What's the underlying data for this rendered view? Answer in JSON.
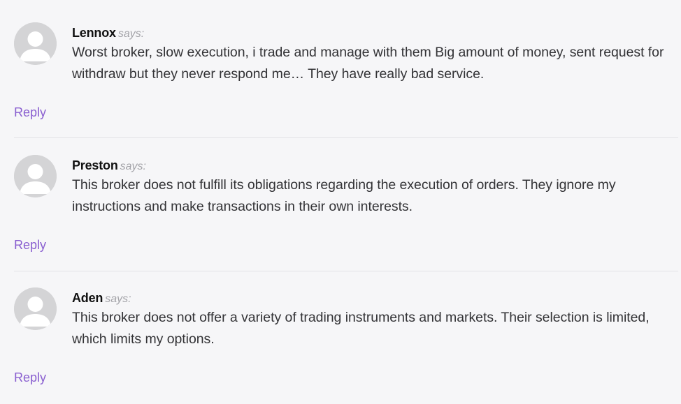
{
  "comments": [
    {
      "author": "Lennox",
      "says": "says:",
      "text": "Worst broker, slow execution, i trade and manage with them Big amount of money, sent request for withdraw but they never respond me… They have really bad service.",
      "reply_label": "Reply"
    },
    {
      "author": "Preston",
      "says": "says:",
      "text": "This broker does not fulfill its obligations regarding the execution of orders. They ignore my instructions and make transactions in their own interests.",
      "reply_label": "Reply"
    },
    {
      "author": "Aden",
      "says": "says:",
      "text": "This broker does not offer a variety of trading instruments and markets. Their selection is limited, which limits my options.",
      "reply_label": "Reply"
    }
  ],
  "colors": {
    "background": "#f6f6f8",
    "reply_link": "#8a5fd0",
    "avatar_bg": "#d4d4d6",
    "divider": "#e2e2e6"
  },
  "icons": {
    "avatar": "default-user-avatar-icon"
  }
}
